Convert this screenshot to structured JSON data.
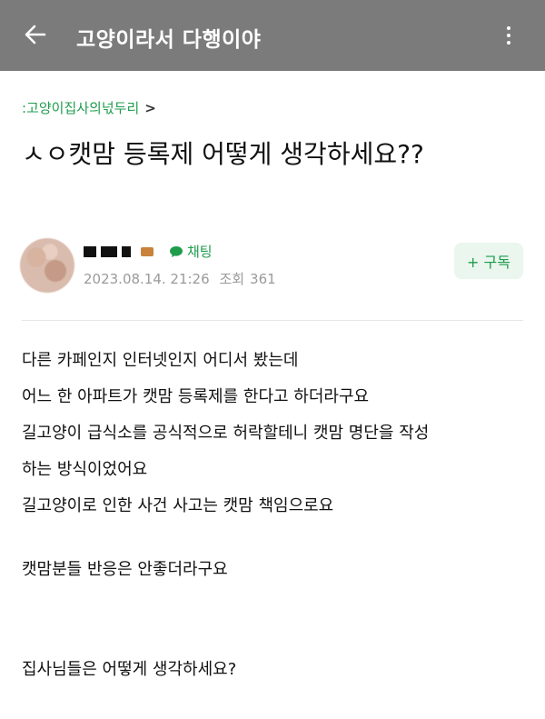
{
  "appbar": {
    "title": "고양이라서 다행이야",
    "back_icon": "arrow-left-icon",
    "more_icon": "more-vertical-icon"
  },
  "post": {
    "board": ":고양이집사의넋두리",
    "board_chevron": ">",
    "title": "ㅅㅇ캣맘 등록제 어떻게 생각하세요??",
    "author": {
      "chat_label": "채팅",
      "date": "2023.08.14. 21:26",
      "views_label": "조회",
      "views": "361"
    },
    "subscribe_label": "+ 구독",
    "body_lines": [
      "다른 카페인지 인터넷인지 어디서 봤는데",
      "어느 한 아파트가 캣맘 등록제를 한다고 하더라구요",
      "길고양이 급식소를 공식적으로 허락할테니 캣맘 명단을 작성",
      "하는 방식이었어요",
      "길고양이로 인한 사건 사고는 캣맘 책임으로요",
      "캣맘분들 반응은 안좋더라구요",
      "집사님들은 어떻게 생각하세요?"
    ]
  },
  "colors": {
    "appbar": "#7b7b7b",
    "accent_green": "#1f9d4d",
    "subscribe_bg": "#eaf6ee"
  }
}
